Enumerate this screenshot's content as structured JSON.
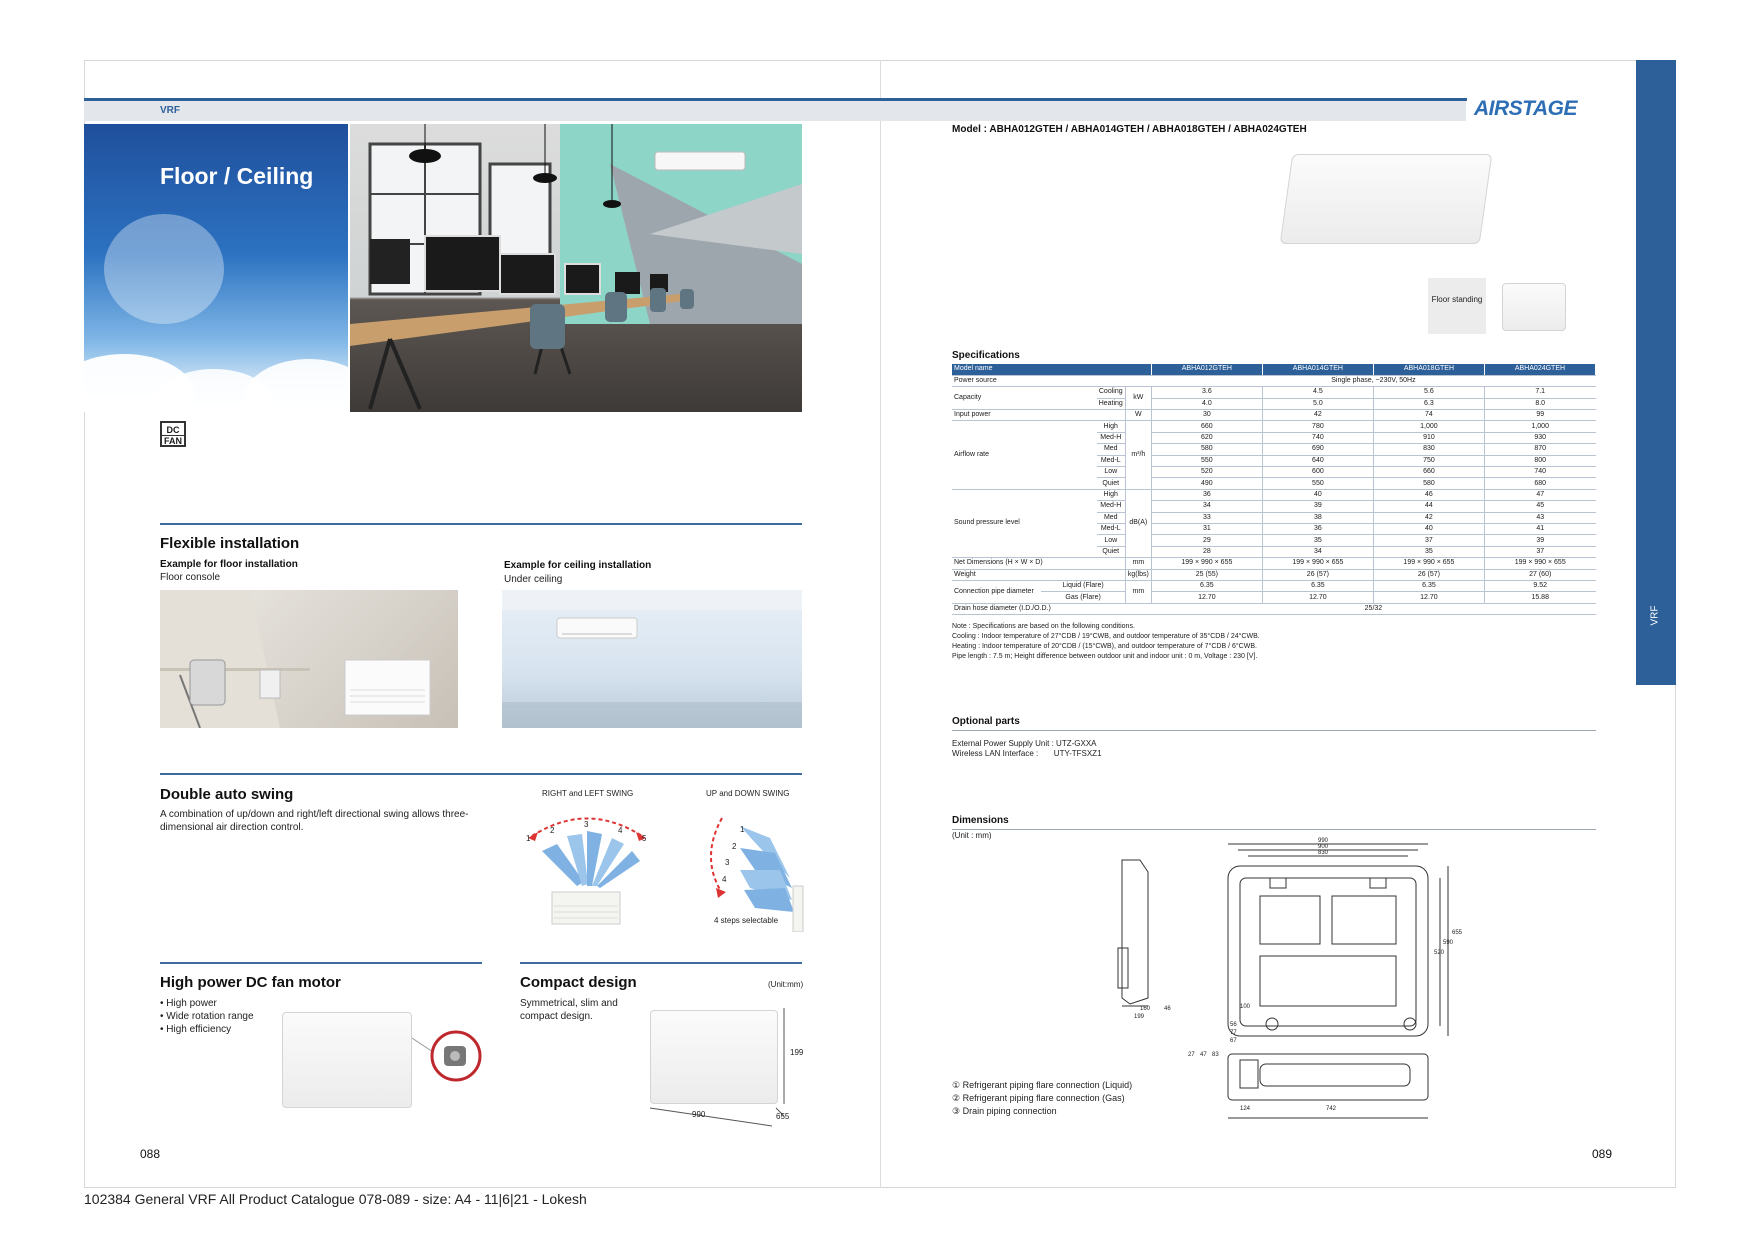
{
  "header": {
    "section": "VRF",
    "brand": "AIRSTAGE",
    "side_tab": "VRF"
  },
  "left_page": {
    "hero_title": "Floor / Ceiling",
    "badge": {
      "line1": "DC",
      "line2": "FAN"
    },
    "flexible": {
      "title": "Flexible installation",
      "floor_heading": "Example for floor installation",
      "floor_sub": "Floor console",
      "ceiling_heading": "Example for ceiling installation",
      "ceiling_sub": "Under ceiling"
    },
    "swing": {
      "title": "Double auto swing",
      "desc": "A combination of up/down and right/left directional swing  allows three-dimensional air direction control.",
      "rl_label": "RIGHT and LEFT SWING",
      "ud_label": "UP and DOWN SWING",
      "rl_steps": [
        "1",
        "2",
        "3",
        "4",
        "5"
      ],
      "ud_steps": [
        "1",
        "2",
        "3",
        "4"
      ],
      "ud_caption": "4 steps selectable"
    },
    "motor": {
      "title": "High power DC fan motor",
      "bullets": [
        "• High power",
        "• Wide rotation range",
        "• High efficiency"
      ]
    },
    "compact": {
      "title": "Compact design",
      "unit": "(Unit:mm)",
      "desc": "Symmetrical, slim and compact design.",
      "dim_h": "199",
      "dim_w": "990",
      "dim_d": "655"
    },
    "page_number": "088"
  },
  "right_page": {
    "model_title": "Model : ABHA012GTEH / ABHA014GTEH / ABHA018GTEH / ABHA024GTEH",
    "floor_standing": "Floor standing",
    "spec_title": "Specifications",
    "spec": {
      "header": [
        "Model name",
        "ABHA012GTEH",
        "ABHA014GTEH",
        "ABHA018GTEH",
        "ABHA024GTEH"
      ],
      "power_source": {
        "label": "Power source",
        "value": "Single phase, ~230V, 50Hz"
      },
      "capacity": {
        "label": "Capacity",
        "unit": "kW",
        "rows": [
          {
            "sub": "Cooling",
            "values": [
              "3.6",
              "4.5",
              "5.6",
              "7.1"
            ]
          },
          {
            "sub": "Heating",
            "values": [
              "4.0",
              "5.0",
              "6.3",
              "8.0"
            ]
          }
        ]
      },
      "input_power": {
        "label": "Input power",
        "unit": "W",
        "values": [
          "30",
          "42",
          "74",
          "99"
        ]
      },
      "airflow": {
        "label": "Airflow rate",
        "unit": "m³/h",
        "rows": [
          {
            "sub": "High",
            "values": [
              "660",
              "780",
              "1,000",
              "1,000"
            ]
          },
          {
            "sub": "Med-H",
            "values": [
              "620",
              "740",
              "910",
              "930"
            ]
          },
          {
            "sub": "Med",
            "values": [
              "580",
              "690",
              "830",
              "870"
            ]
          },
          {
            "sub": "Med-L",
            "values": [
              "550",
              "640",
              "750",
              "800"
            ]
          },
          {
            "sub": "Low",
            "values": [
              "520",
              "600",
              "660",
              "740"
            ]
          },
          {
            "sub": "Quiet",
            "values": [
              "490",
              "550",
              "580",
              "680"
            ]
          }
        ]
      },
      "sound": {
        "label": "Sound pressure level",
        "unit": "dB(A)",
        "rows": [
          {
            "sub": "High",
            "values": [
              "36",
              "40",
              "46",
              "47"
            ]
          },
          {
            "sub": "Med-H",
            "values": [
              "34",
              "39",
              "44",
              "45"
            ]
          },
          {
            "sub": "Med",
            "values": [
              "33",
              "38",
              "42",
              "43"
            ]
          },
          {
            "sub": "Med-L",
            "values": [
              "31",
              "36",
              "40",
              "41"
            ]
          },
          {
            "sub": "Low",
            "values": [
              "29",
              "35",
              "37",
              "39"
            ]
          },
          {
            "sub": "Quiet",
            "values": [
              "28",
              "34",
              "35",
              "37"
            ]
          }
        ]
      },
      "dimensions": {
        "label": "Net Dimensions (H × W × D)",
        "unit": "mm",
        "values": [
          "199 × 990 × 655",
          "199 × 990 × 655",
          "199 × 990 × 655",
          "199 × 990 × 655"
        ]
      },
      "weight": {
        "label": "Weight",
        "unit": "kg(lbs)",
        "values": [
          "25 (55)",
          "26 (57)",
          "26 (57)",
          "27 (60)"
        ]
      },
      "pipe": {
        "label": "Connection pipe diameter",
        "unit": "mm",
        "rows": [
          {
            "sub": "Liquid (Flare)",
            "values": [
              "6.35",
              "6.35",
              "6.35",
              "9.52"
            ]
          },
          {
            "sub": "Gas (Flare)",
            "values": [
              "12.70",
              "12.70",
              "12.70",
              "15.88"
            ]
          }
        ]
      },
      "drain": {
        "label": "Drain hose diameter (I.D./O.D.)",
        "value": "25/32"
      }
    },
    "notes": [
      "Note : Specifications are based on the following conditions.",
      "Cooling : Indoor temperature of 27°CDB / 19°CWB, and outdoor temperature of 35°CDB / 24°CWB.",
      "Heating : Indoor temperature of 20°CDB / (15°CWB), and outdoor temperature of 7°CDB / 6°CWB.",
      "Pipe length : 7.5 m; Height difference between outdoor unit and indoor unit : 0 m, Voltage : 230 [V]."
    ],
    "optional_title": "Optional parts",
    "optional_items": [
      "External Power Supply Unit : UTZ-GXXA",
      "Wireless LAN Interface :       UTY-TFSXZ1"
    ],
    "dimensions_title": "Dimensions",
    "dimensions_unit": "(Unit : mm)",
    "drawing_labels": [
      "990",
      "900",
      "830",
      "655",
      "590",
      "520",
      "199",
      "160",
      "46",
      "100",
      "124",
      "742",
      "56",
      "77",
      "67",
      "27",
      "47",
      "83"
    ],
    "legend": [
      "① Refrigerant piping flare connection (Liquid)",
      "② Refrigerant piping flare connection (Gas)",
      "③ Drain piping connection"
    ],
    "page_number": "089"
  },
  "footer": "102384 General VRF All Product Catalogue 078-089 - size: A4 - 11|6|21 - Lokesh"
}
